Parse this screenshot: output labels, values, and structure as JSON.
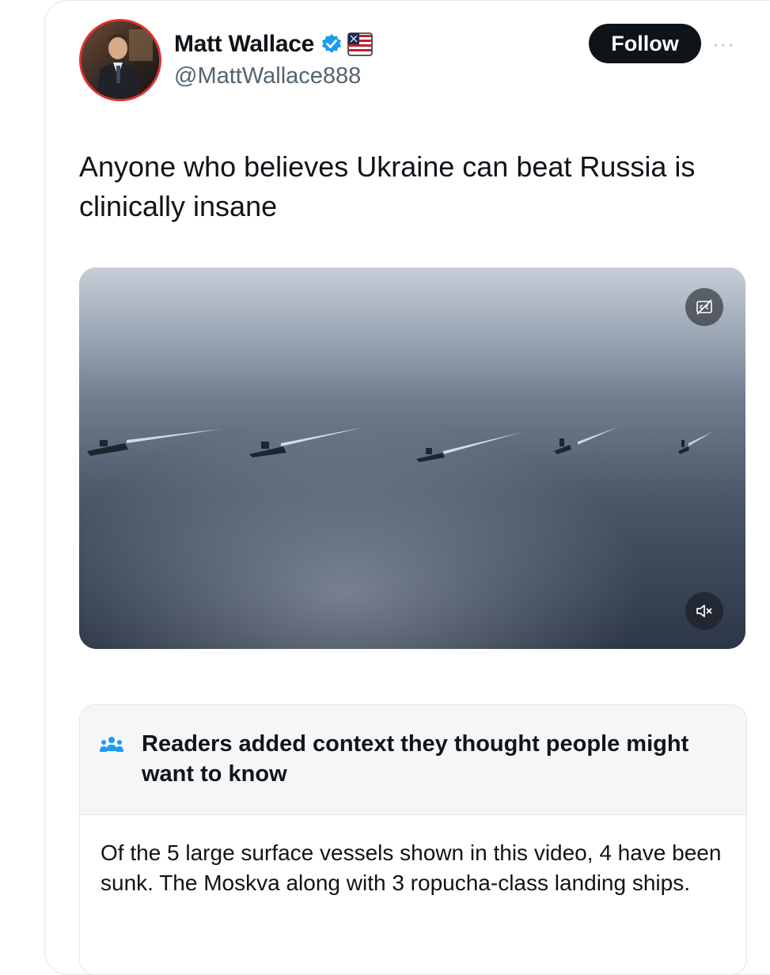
{
  "author": {
    "display_name": "Matt Wallace",
    "handle": "@MattWallace888",
    "avatar_icon": "profile-photo",
    "badge_icon": "verified-badge-icon",
    "flag_icon": "us-flag-icon"
  },
  "actions": {
    "follow_label": "Follow",
    "more_label": "···"
  },
  "tweet": {
    "text": "Anyone who believes Ukraine can beat Russia is clinically insane"
  },
  "media": {
    "type": "video",
    "captions_icon": "captions-off-icon",
    "mute_icon": "muted-speaker-icon"
  },
  "community_note": {
    "icon": "people-icon",
    "title": "Readers added context they thought people might want to know",
    "body": "Of the 5 large surface vessels shown in this video, 4 have been sunk. The Moskva along with 3 ropucha-class landing ships."
  },
  "colors": {
    "verified_blue": "#1d9bf0",
    "follow_bg": "#0f1419",
    "handle_gray": "#536471",
    "note_header_bg": "#f4f6f8",
    "avatar_ring": "#e0312f"
  }
}
